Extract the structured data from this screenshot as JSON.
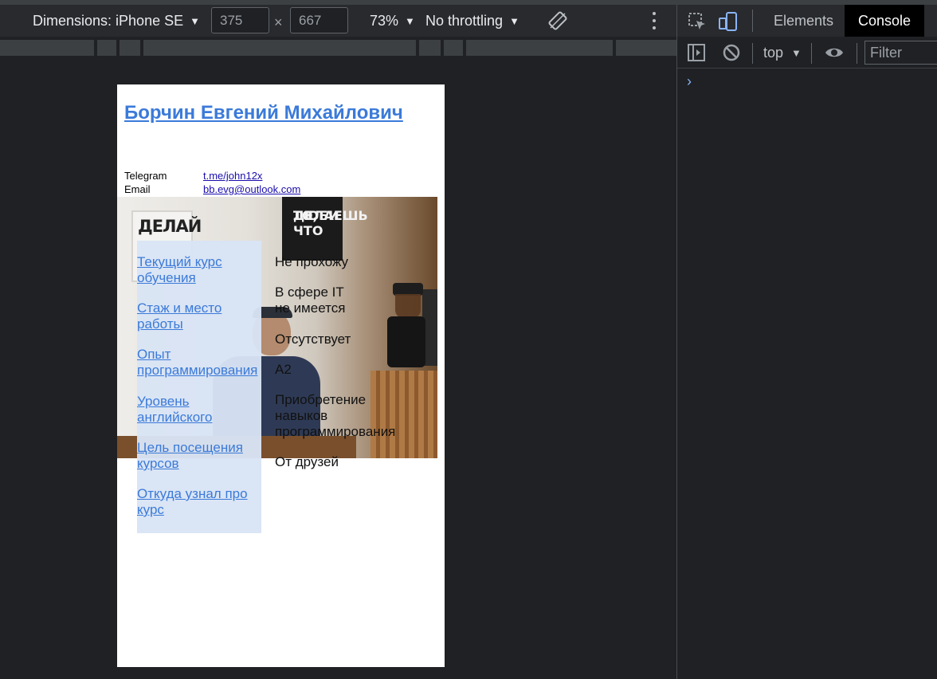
{
  "device_toolbar": {
    "dimensions_label": "Dimensions: iPhone SE",
    "width_value": "375",
    "height_value": "667",
    "times": "×",
    "zoom": "73%",
    "throttling": "No throttling"
  },
  "devtools": {
    "tabs": [
      {
        "label": "Elements",
        "active": false
      },
      {
        "label": "Console",
        "active": true
      }
    ],
    "console": {
      "context": "top",
      "filter_placeholder": "Filter",
      "prompt": "›"
    }
  },
  "page": {
    "name": "Борчин Евгений Михайлович",
    "contacts": [
      {
        "label": "Telegram",
        "value": "t.me/john12x"
      },
      {
        "label": "Email",
        "value": "bb.evg@outlook.com"
      }
    ],
    "photo": {
      "poster_left": "ДЕЛАЙ",
      "poster_right": [
        "ЛЮБИ",
        "ТО, ЧТО",
        "ДЕЛАЕШЬ"
      ]
    },
    "nav": [
      "Текущий курс обучения",
      "Стаж и место работы",
      "Опыт программирования",
      "Уровень английского",
      "Цель посещения курсов",
      "Откуда узнал про курс"
    ],
    "values": [
      "Не прохожу",
      "В сфере IT не имеется",
      "Отсутствует",
      "А2",
      "Приобретение навыков программирования",
      "От друзей"
    ]
  },
  "colors": {
    "link": "#3b7ad9",
    "nav_panel_bg": "#d8e4f5",
    "devtools_bg": "#202124",
    "prompt": "#8ab4f8"
  }
}
